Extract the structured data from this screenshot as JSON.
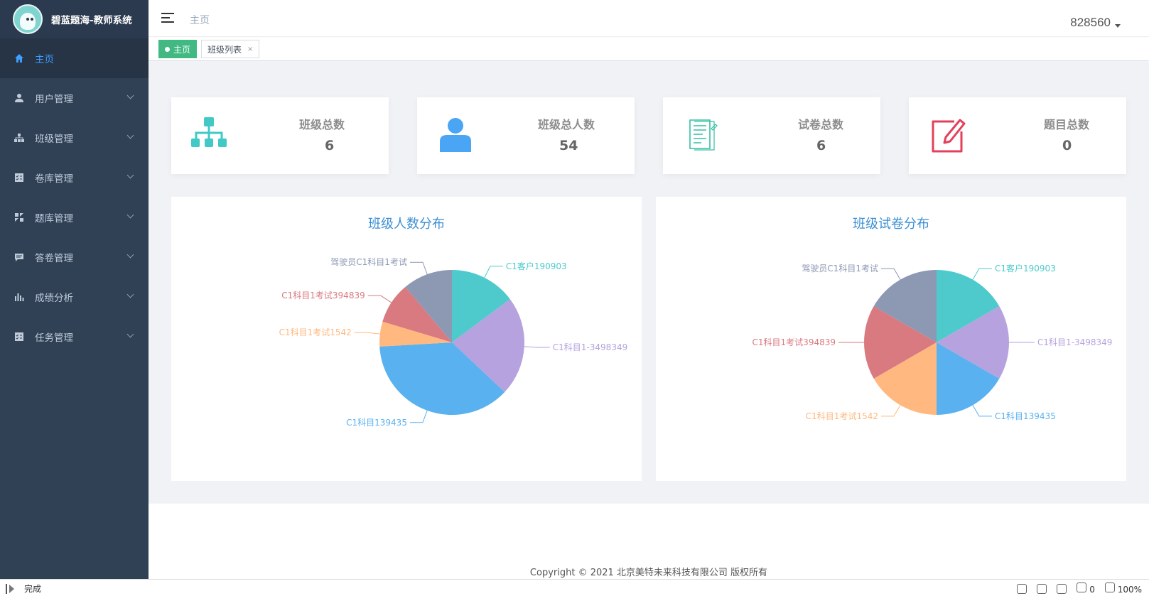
{
  "app": {
    "title": "碧蓝题海-教师系统"
  },
  "sidebar": {
    "items": [
      {
        "label": "主页",
        "icon": "home-icon",
        "active": true
      },
      {
        "label": "用户管理",
        "icon": "user-icon"
      },
      {
        "label": "班级管理",
        "icon": "sitemap-icon"
      },
      {
        "label": "卷库管理",
        "icon": "checklist-icon"
      },
      {
        "label": "题库管理",
        "icon": "puzzle-icon"
      },
      {
        "label": "答卷管理",
        "icon": "comment-icon"
      },
      {
        "label": "成绩分析",
        "icon": "bar-chart-icon"
      },
      {
        "label": "任务管理",
        "icon": "task-icon"
      }
    ]
  },
  "header": {
    "breadcrumb": "主页",
    "username": "828560"
  },
  "tags": [
    {
      "label": "主页",
      "active": true
    },
    {
      "label": "班级列表",
      "close": "×"
    }
  ],
  "stats": [
    {
      "label": "班级总数",
      "value": "6",
      "icon": "sitemap-icon",
      "color": "#40c9c6"
    },
    {
      "label": "班级总人数",
      "value": "54",
      "icon": "user-icon",
      "color": "#36a3f7"
    },
    {
      "label": "试卷总数",
      "value": "6",
      "icon": "document-icon",
      "color": "#34bfa3"
    },
    {
      "label": "题目总数",
      "value": "0",
      "icon": "edit-icon",
      "color": "#e43f5b"
    }
  ],
  "chart_data": [
    {
      "type": "pie",
      "title": "班级人数分布",
      "categories": [
        "C1客户190903",
        "C1科目1-3498349",
        "C1科目139435",
        "C1科目1考试1542",
        "C1科目1考试394839",
        "驾驶员C1科目1考试"
      ],
      "values": [
        8,
        12,
        20,
        3,
        5,
        6
      ],
      "colors": [
        "#4ecacc",
        "#b6a2de",
        "#5ab1ef",
        "#ffb980",
        "#d87a80",
        "#8d98b3"
      ]
    },
    {
      "type": "pie",
      "title": "班级试卷分布",
      "categories": [
        "C1客户190903",
        "C1科目1-3498349",
        "C1科目139435",
        "C1科目1考试1542",
        "C1科目1考试394839",
        "驾驶员C1科目1考试"
      ],
      "values": [
        1,
        1,
        1,
        1,
        1,
        1
      ],
      "colors": [
        "#4ecacc",
        "#b6a2de",
        "#5ab1ef",
        "#ffb980",
        "#d87a80",
        "#8d98b3"
      ]
    }
  ],
  "footer": {
    "copyright": "Copyright © 2021 北京美特未来科技有限公司 版权所有"
  },
  "statusbar": {
    "status": "完成",
    "counter": "0",
    "zoom": "100%"
  }
}
